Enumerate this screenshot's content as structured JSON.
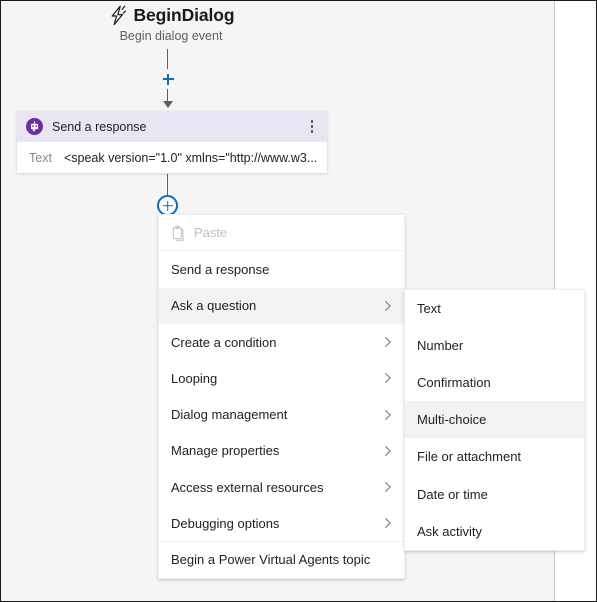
{
  "trigger": {
    "icon": "lightning-bolt-icon",
    "title": "BeginDialog",
    "subtitle": "Begin dialog event"
  },
  "connectors": {
    "upper_plus_label": "+",
    "lower_plus_label": "+"
  },
  "node": {
    "icon": "bot-chat-icon",
    "title": "Send a response",
    "more_icon": "more-vertical-icon",
    "field_label": "Text",
    "field_value": "<speak version=\"1.0\" xmlns=\"http://www.w3...."
  },
  "context_menu": {
    "items": [
      {
        "label": "Paste",
        "icon": "clipboard-icon",
        "disabled": true,
        "submenu": false,
        "highlight": false,
        "separator": true
      },
      {
        "label": "Send a response",
        "icon": null,
        "disabled": false,
        "submenu": false,
        "highlight": false,
        "separator": false
      },
      {
        "label": "Ask a question",
        "icon": null,
        "disabled": false,
        "submenu": true,
        "highlight": true,
        "separator": false
      },
      {
        "label": "Create a condition",
        "icon": null,
        "disabled": false,
        "submenu": true,
        "highlight": false,
        "separator": false
      },
      {
        "label": "Looping",
        "icon": null,
        "disabled": false,
        "submenu": true,
        "highlight": false,
        "separator": false
      },
      {
        "label": "Dialog management",
        "icon": null,
        "disabled": false,
        "submenu": true,
        "highlight": false,
        "separator": false
      },
      {
        "label": "Manage properties",
        "icon": null,
        "disabled": false,
        "submenu": true,
        "highlight": false,
        "separator": false
      },
      {
        "label": "Access external resources",
        "icon": null,
        "disabled": false,
        "submenu": true,
        "highlight": false,
        "separator": false
      },
      {
        "label": "Debugging options",
        "icon": null,
        "disabled": false,
        "submenu": true,
        "highlight": false,
        "separator": true
      },
      {
        "label": "Begin a Power Virtual Agents topic",
        "icon": null,
        "disabled": false,
        "submenu": false,
        "highlight": false,
        "separator": false
      }
    ]
  },
  "submenu": {
    "parent": "Ask a question",
    "items": [
      {
        "label": "Text",
        "highlight": false
      },
      {
        "label": "Number",
        "highlight": false
      },
      {
        "label": "Confirmation",
        "highlight": false
      },
      {
        "label": "Multi-choice",
        "highlight": true
      },
      {
        "label": "File or attachment",
        "highlight": false
      },
      {
        "label": "Date or time",
        "highlight": false
      },
      {
        "label": "Ask activity",
        "highlight": false
      }
    ]
  },
  "colors": {
    "canvas": "#f5f5f5",
    "node_header": "#e9e5f2",
    "node_icon": "#6b2fa0",
    "accent_blue": "#0f6cbd",
    "highlight": "#f3f2f1",
    "connector": "#605e5c"
  }
}
